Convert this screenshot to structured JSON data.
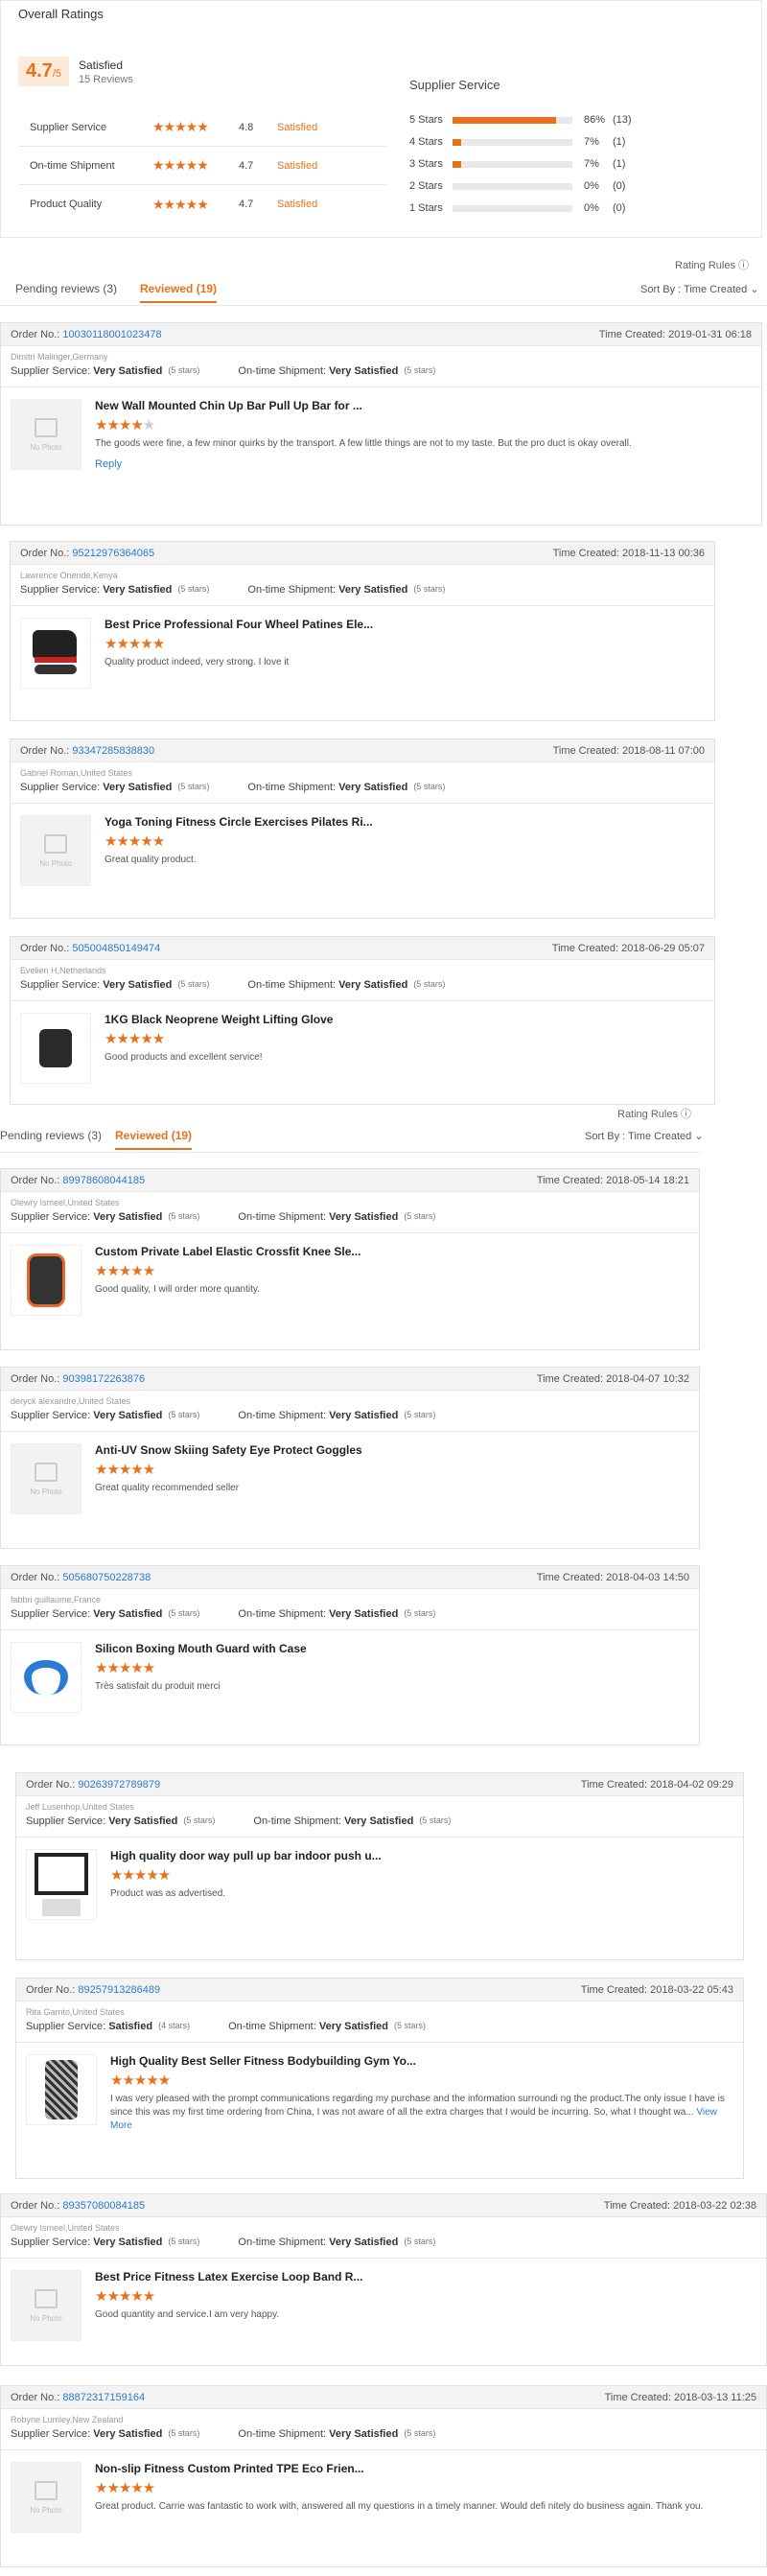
{
  "overall": {
    "title": "Overall Ratings",
    "score": "4.7",
    "score_den": "/5",
    "status": "Satisfied",
    "reviews": "15 Reviews",
    "rows": [
      {
        "label": "Supplier Service",
        "stars": "★★★★★",
        "value": "4.8",
        "status": "Satisfied"
      },
      {
        "label": "On-time Shipment",
        "stars": "★★★★★",
        "value": "4.7",
        "status": "Satisfied"
      },
      {
        "label": "Product Quality",
        "stars": "★★★★★",
        "value": "4.7",
        "status": "Satisfied"
      }
    ],
    "supplier_title": "Supplier Service",
    "distribution": [
      {
        "label": "5 Stars",
        "pct": "86%",
        "count": "(13)",
        "fill": 0.86
      },
      {
        "label": "4 Stars",
        "pct": "7%",
        "count": "(1)",
        "fill": 0.07
      },
      {
        "label": "3 Stars",
        "pct": "7%",
        "count": "(1)",
        "fill": 0.07
      },
      {
        "label": "2 Stars",
        "pct": "0%",
        "count": "(0)",
        "fill": 0
      },
      {
        "label": "1 Stars",
        "pct": "0%",
        "count": "(0)",
        "fill": 0
      }
    ]
  },
  "tabs": {
    "rating_rules": "Rating Rules ⓘ",
    "pending": "Pending reviews (3)",
    "reviewed": "Reviewed (19)",
    "sort": "Sort By : Time Created ⌄"
  },
  "labels": {
    "order_no": "Order No.:",
    "time_created": "Time Created:",
    "supplier_service": "Supplier Service:",
    "ontime": "On-time Shipment:",
    "no_photo": "No Photo",
    "reply": "Reply",
    "view_more": "View More"
  },
  "reviews": [
    {
      "order": "10030118001023478",
      "time": "2019-01-31 06:18",
      "buyer": "Dimitri Malinger,Germany",
      "ss": "Very Satisfied",
      "ss_stars": "(5 stars)",
      "os": "Very Satisfied",
      "os_stars": "(5 stars)",
      "title": "New Wall Mounted Chin Up Bar Pull Up Bar for ...",
      "stars": "★★★★",
      "gray": "★",
      "text": "The goods were fine, a few minor quirks by the transport. A few little things are not to my taste. But the pro duct is okay overall."
    },
    {
      "order": "95212976364065",
      "time": "2018-11-13 00:36",
      "buyer": "Lawrence Onende,Kenya",
      "ss": "Very Satisfied",
      "ss_stars": "(5 stars)",
      "os": "Very Satisfied",
      "os_stars": "(5 stars)",
      "title": "Best Price Professional Four Wheel Patines Ele...",
      "stars": "★★★★★",
      "gray": "",
      "text": "Quality product indeed, very strong. I love it"
    },
    {
      "order": "93347285838830",
      "time": "2018-08-11 07:00",
      "buyer": "Gabriel Roman,United States",
      "ss": "Very Satisfied",
      "ss_stars": "(5 stars)",
      "os": "Very Satisfied",
      "os_stars": "(5 stars)",
      "title": "Yoga Toning Fitness Circle Exercises Pilates Ri...",
      "stars": "★★★★★",
      "gray": "",
      "text": "Great quality product."
    },
    {
      "order": "505004850149474",
      "time": "2018-06-29 05:07",
      "buyer": "Evelien H,Netherlands",
      "ss": "Very Satisfied",
      "ss_stars": "(5 stars)",
      "os": "Very Satisfied",
      "os_stars": "(5 stars)",
      "title": "1KG Black Neoprene Weight Lifting Glove",
      "stars": "★★★★★",
      "gray": "",
      "text": "Good products and excellent service!"
    },
    {
      "order": "89978608044185",
      "time": "2018-05-14 18:21",
      "buyer": "Olewry Ismeel,United States",
      "ss": "Very Satisfied",
      "ss_stars": "(5 stars)",
      "os": "Very Satisfied",
      "os_stars": "(5 stars)",
      "title": "Custom Private Label Elastic Crossfit Knee Sle...",
      "stars": "★★★★★",
      "gray": "",
      "text": "Good quality, I will order more quantity."
    },
    {
      "order": "90398172263876",
      "time": "2018-04-07 10:32",
      "buyer": "deryck alexandre,United States",
      "ss": "Very Satisfied",
      "ss_stars": "(5 stars)",
      "os": "Very Satisfied",
      "os_stars": "(5 stars)",
      "title": "Anti-UV Snow Skiing Safety Eye Protect Goggles",
      "stars": "★★★★★",
      "gray": "",
      "text": "Great quality recommended seller"
    },
    {
      "order": "505680750228738",
      "time": "2018-04-03 14:50",
      "buyer": "fabbri guillaume,France",
      "ss": "Very Satisfied",
      "ss_stars": "(5 stars)",
      "os": "Very Satisfied",
      "os_stars": "(5 stars)",
      "title": "Silicon Boxing Mouth Guard with Case",
      "stars": "★★★★★",
      "gray": "",
      "text": "Très satisfait du produit merci"
    },
    {
      "order": "90263972789879",
      "time": "2018-04-02 09:29",
      "buyer": "Jeff Lusenhop,United States",
      "ss": "Very Satisfied",
      "ss_stars": "(5 stars)",
      "os": "Very Satisfied",
      "os_stars": "(5 stars)",
      "title": "High quality door way pull up bar indoor push u...",
      "stars": "★★★★★",
      "gray": "",
      "text": "Product was as advertised."
    },
    {
      "order": "89257913286489",
      "time": "2018-03-22 05:43",
      "buyer": "Rita Garnto,United States",
      "ss": "Satisfied",
      "ss_stars": "(4 stars)",
      "os": "Very Satisfied",
      "os_stars": "(5 stars)",
      "title": "High Quality Best Seller Fitness Bodybuilding Gym Yo...",
      "stars": "★★★★★",
      "gray": "",
      "text": "I was very pleased with the prompt communications regarding my purchase and the information surroundi ng the product.The only issue I have is since this was my first time ordering from China, I was not aware of all the extra charges that I would be incurring. So, what I thought wa..."
    },
    {
      "order": "89357080084185",
      "time": "2018-03-22 02:38",
      "buyer": "Olewry Ismeel,United States",
      "ss": "Very Satisfied",
      "ss_stars": "(5 stars)",
      "os": "Very Satisfied",
      "os_stars": "(5 stars)",
      "title": "Best Price Fitness Latex Exercise Loop Band R...",
      "stars": "★★★★★",
      "gray": "",
      "text": "Good quantity and service.I am very happy."
    },
    {
      "order": "88872317159164",
      "time": "2018-03-13 11:25",
      "buyer": "Robyne Lumley,New Zealand",
      "ss": "Very Satisfied",
      "ss_stars": "(5 stars)",
      "os": "Very Satisfied",
      "os_stars": "(5 stars)",
      "title": "Non-slip Fitness Custom Printed TPE Eco Frien...",
      "stars": "★★★★★",
      "gray": "",
      "text": "Great product. Carrie was fantastic to work with, answered all my questions in a timely manner. Would defi nitely do business again. Thank you."
    }
  ]
}
